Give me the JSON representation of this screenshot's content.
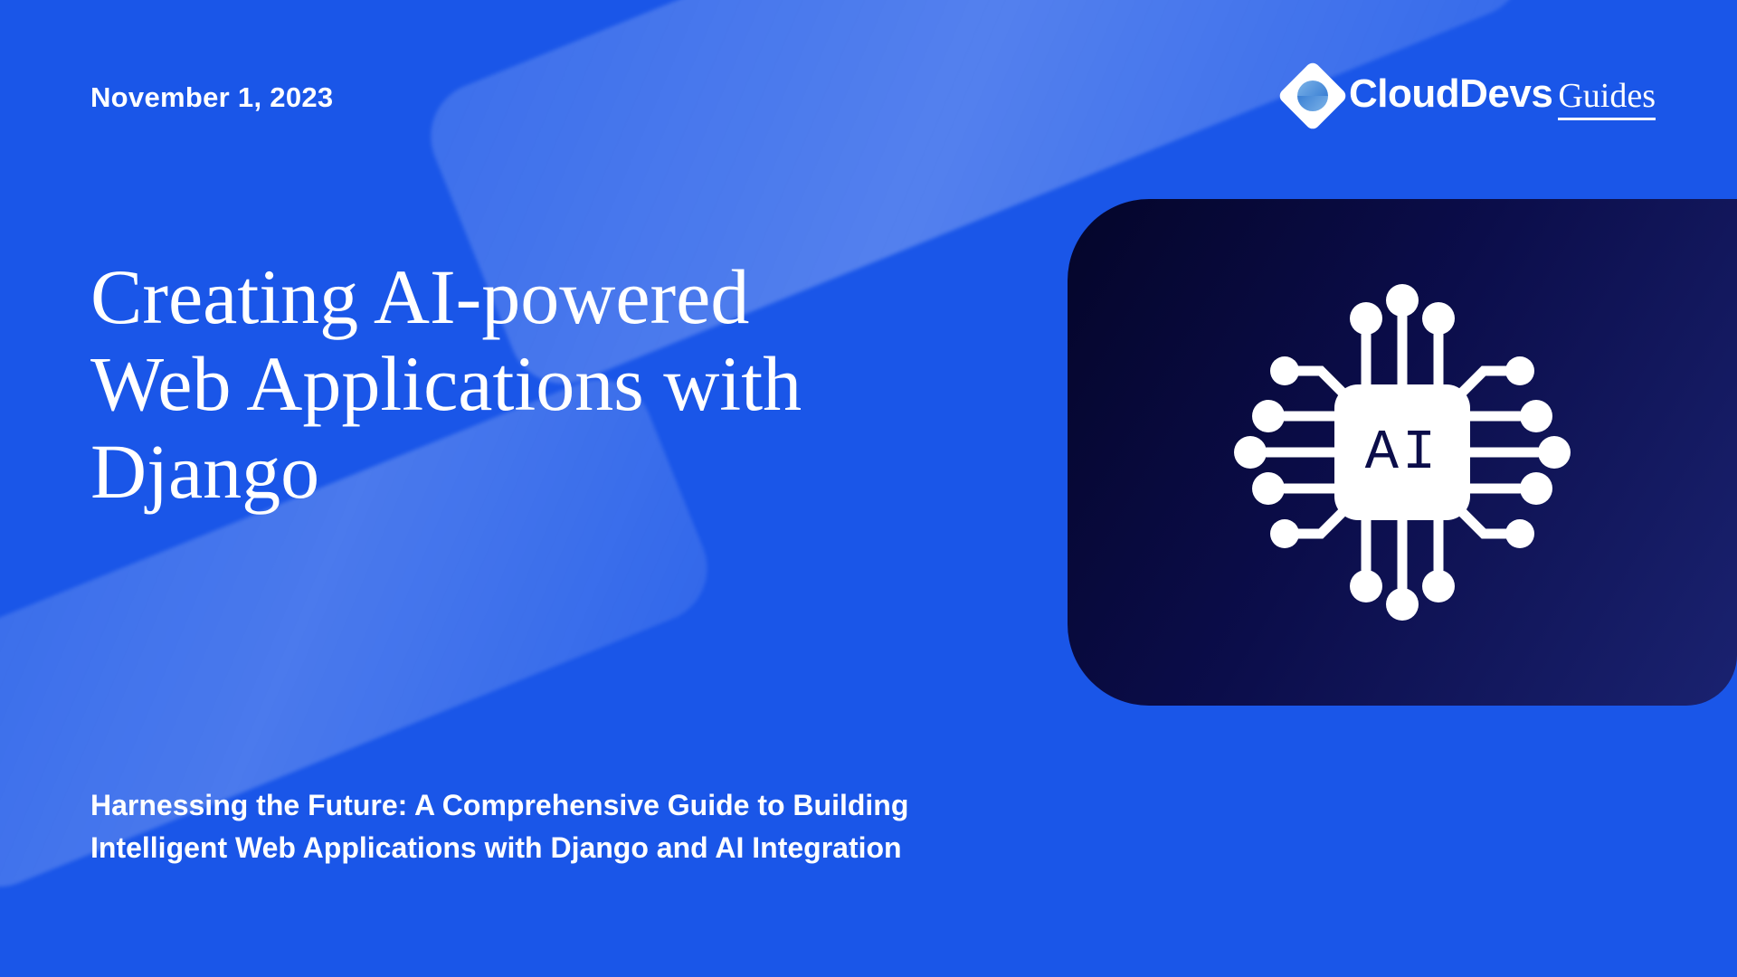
{
  "date": "November 1, 2023",
  "brand": {
    "name": "CloudDevs",
    "suffix": "Guides",
    "icon_name": "clouddevs-logo"
  },
  "title": "Creating AI-powered Web Applications with Django",
  "subtitle": "Harnessing the Future: A Comprehensive Guide to Building Intelligent Web Applications with Django and AI Integration",
  "ai_chip": {
    "label": "AI",
    "icon_name": "ai-chip-icon"
  },
  "colors": {
    "background": "#1a56e8",
    "card_gradient_from": "#04052a",
    "card_gradient_to": "#1a2270",
    "text": "#ffffff"
  }
}
